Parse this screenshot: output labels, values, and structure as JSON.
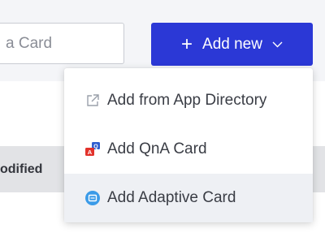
{
  "search": {
    "value": "a Card"
  },
  "add_new": {
    "label": "Add new"
  },
  "table": {
    "column_header": "odified"
  },
  "menu": {
    "items": [
      {
        "label": "Add from App Directory",
        "icon": "external-link-icon"
      },
      {
        "label": "Add QnA Card",
        "icon": "qna-card-icon"
      },
      {
        "label": "Add Adaptive Card",
        "icon": "adaptive-card-icon"
      }
    ]
  },
  "colors": {
    "primary": "#2b38d6",
    "menu_hover": "#eef0f4"
  }
}
